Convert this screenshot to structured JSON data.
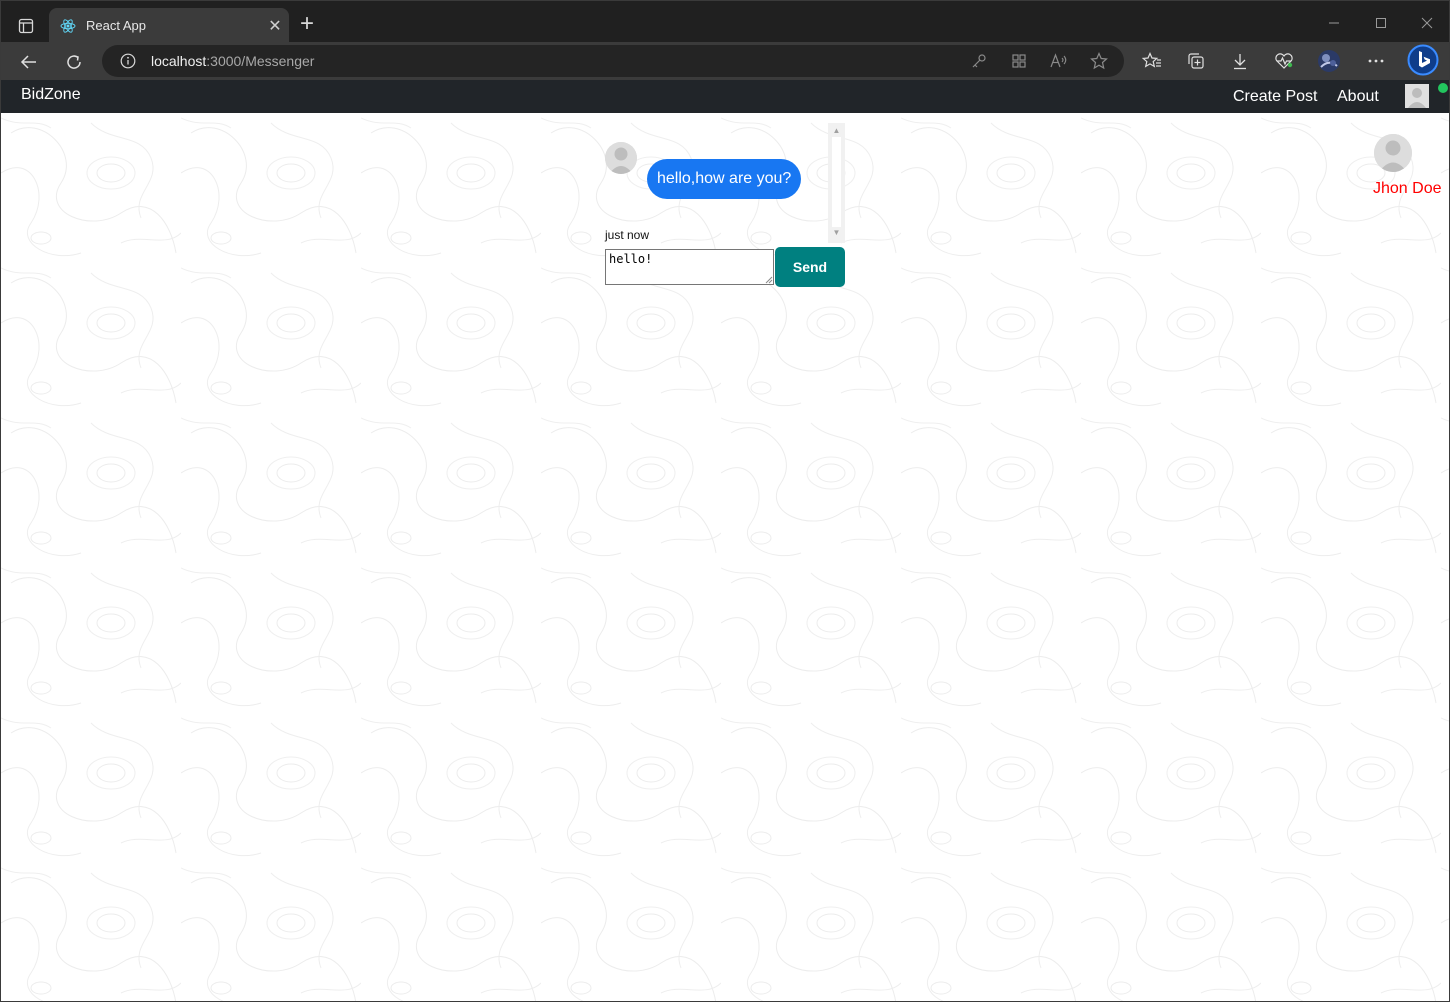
{
  "browser": {
    "tab_title": "React App",
    "url_host": "localhost",
    "url_path": ":3000/Messenger"
  },
  "navbar": {
    "brand": "BidZone",
    "links": [
      "Create Post",
      "About"
    ]
  },
  "chat": {
    "messages": [
      {
        "text": "hello,how are you?",
        "time": "just now"
      }
    ],
    "input_value": "hello!",
    "send_label": "Send"
  },
  "online_users": [
    {
      "name": "Jhon Doe"
    }
  ],
  "colors": {
    "bubble": "#1877f2",
    "send_button": "#008080",
    "online_name": "#ff0000",
    "navbar": "#212529",
    "online_indicator": "#22c55e"
  }
}
